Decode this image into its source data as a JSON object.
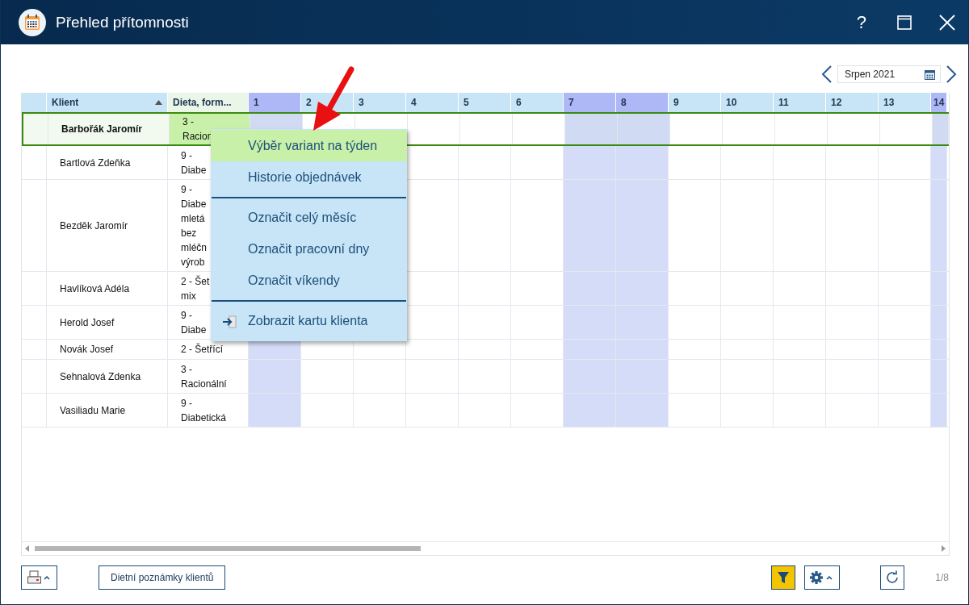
{
  "window": {
    "title": "Přehled přítomnosti",
    "help": "?"
  },
  "month": {
    "value": "Srpen 2021"
  },
  "columns": [
    {
      "label": "Klient",
      "sorted": true
    },
    {
      "label": "Dieta, form..."
    }
  ],
  "days": [
    {
      "label": "1",
      "weekend": true
    },
    {
      "label": "2",
      "weekend": false
    },
    {
      "label": "3",
      "weekend": false
    },
    {
      "label": "4",
      "weekend": false
    },
    {
      "label": "5",
      "weekend": false
    },
    {
      "label": "6",
      "weekend": false
    },
    {
      "label": "7",
      "weekend": true
    },
    {
      "label": "8",
      "weekend": true
    },
    {
      "label": "9",
      "weekend": false
    },
    {
      "label": "10",
      "weekend": false
    },
    {
      "label": "11",
      "weekend": false
    },
    {
      "label": "12",
      "weekend": false
    },
    {
      "label": "13",
      "weekend": false
    },
    {
      "label": "14",
      "weekend": true
    }
  ],
  "rows": [
    {
      "client": "Barbořák Jaromír",
      "diet": [
        "3 -",
        "Racion"
      ],
      "selected": true
    },
    {
      "client": "Bartlová Zdeňka",
      "diet": [
        "9 -",
        "Diabe"
      ],
      "selected": false
    },
    {
      "client": "Bezděk Jaromír",
      "diet": [
        "9 -",
        "Diabe",
        "mletá",
        "bez",
        "mléčn",
        "výrob"
      ],
      "selected": false
    },
    {
      "client": "Havlíková Adéla",
      "diet": [
        "2 - Šet",
        "mix"
      ],
      "selected": false
    },
    {
      "client": "Herold Josef",
      "diet": [
        "9 -",
        "Diabe"
      ],
      "selected": false
    },
    {
      "client": "Novák Josef",
      "diet": [
        "2 - Šetřící"
      ],
      "selected": false
    },
    {
      "client": "Sehnalová Zdenka",
      "diet": [
        "3 -",
        "Racionální"
      ],
      "selected": false
    },
    {
      "client": "Vasiliadu Marie",
      "diet": [
        "9 -",
        "Diabetická"
      ],
      "selected": false
    }
  ],
  "context_menu": [
    {
      "kind": "item",
      "label": "Výběr variant na týden",
      "selected": true
    },
    {
      "kind": "item",
      "label": "Historie objednávek",
      "selected": false
    },
    {
      "kind": "separator"
    },
    {
      "kind": "item",
      "label": "Označit celý měsíc",
      "selected": false
    },
    {
      "kind": "item",
      "label": "Označit pracovní dny",
      "selected": false
    },
    {
      "kind": "item",
      "label": "Označit víkendy",
      "selected": false
    },
    {
      "kind": "separator"
    },
    {
      "kind": "icon-item",
      "label": "Zobrazit kartu klienta",
      "selected": false
    }
  ],
  "footer": {
    "notes_button": "Dietní poznámky klientů",
    "filter_active": true,
    "page": "1/8"
  }
}
